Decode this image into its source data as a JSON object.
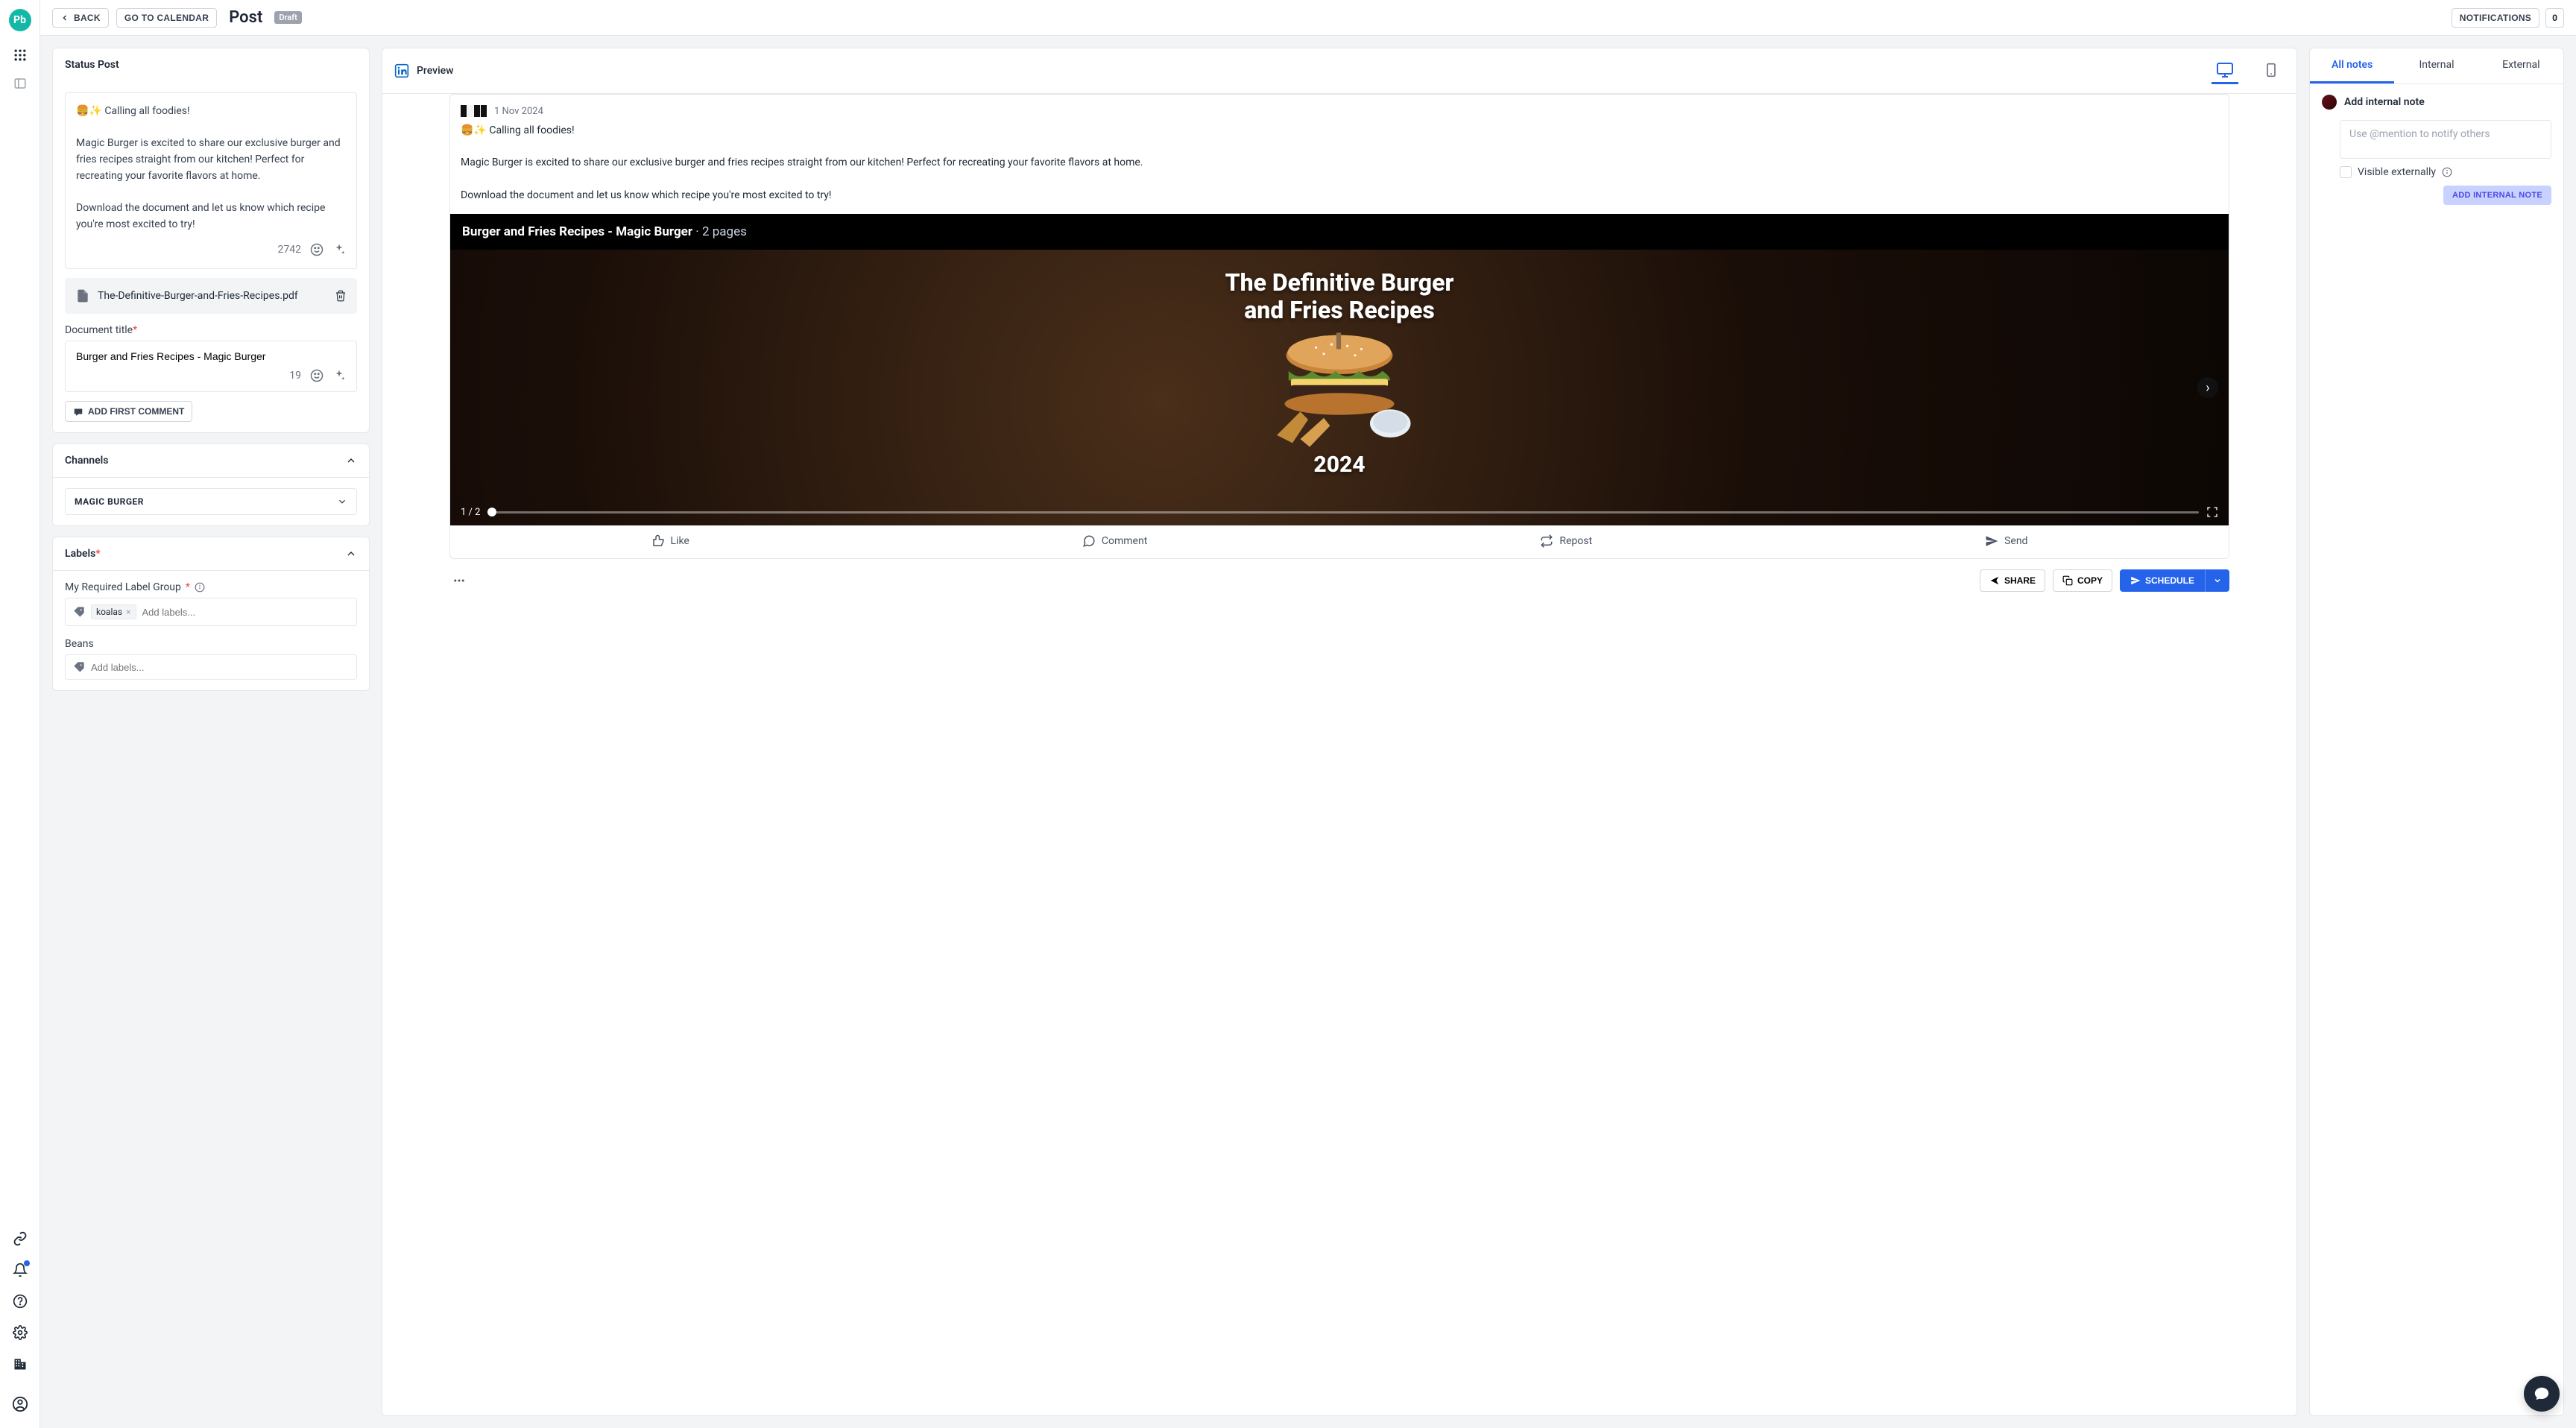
{
  "logo_text": "Pb",
  "topbar": {
    "back": "BACK",
    "calendar": "GO TO CALENDAR",
    "title": "Post",
    "badge": "Draft",
    "notifications": "NOTIFICATIONS",
    "notif_count": "0"
  },
  "status": {
    "header": "Status Post",
    "text_line1": "🍔✨ Calling all foodies!",
    "text_line2": "Magic Burger is excited to share our exclusive burger and fries recipes straight from our kitchen! Perfect for recreating your favorite flavors at home.",
    "text_line3": "Download the document and let us know which recipe you're most excited to try!",
    "char_count": "2742",
    "file_name": "The-Definitive-Burger-and-Fries-Recipes.pdf",
    "doc_title_label": "Document title",
    "doc_title_value": "Burger and Fries Recipes - Magic Burger",
    "doc_title_remaining": "19",
    "add_first_comment": "ADD FIRST COMMENT"
  },
  "channels": {
    "header": "Channels",
    "selected": "MAGIC BURGER"
  },
  "labels": {
    "header": "Labels",
    "group1_label": "My Required Label Group",
    "group1_tag": "koalas",
    "add_labels_placeholder": "Add labels...",
    "group2_label": "Beans"
  },
  "preview": {
    "header": "Preview",
    "date": "1 Nov 2024",
    "text_line1": "🍔✨ Calling all foodies!",
    "text_line2": "Magic Burger is excited to share our exclusive burger and fries recipes straight from our kitchen! Perfect for recreating your favorite flavors at home.",
    "text_line3": "Download the document and let us know which recipe you're most excited to try!",
    "doc_bar_title": "Burger and Fries Recipes - Magic Burger",
    "doc_bar_pages": "2 pages",
    "doc_title_line1": "The Definitive Burger",
    "doc_title_line2": "and Fries Recipes",
    "year": "2024",
    "page_indicator": "1 / 2",
    "actions": {
      "like": "Like",
      "comment": "Comment",
      "repost": "Repost",
      "send": "Send"
    }
  },
  "bottom": {
    "share": "SHARE",
    "copy": "COPY",
    "schedule": "SCHEDULE"
  },
  "notes": {
    "tabs": {
      "all": "All notes",
      "internal": "Internal",
      "external": "External"
    },
    "add_label": "Add internal note",
    "placeholder": "Use @mention to notify others",
    "checkbox": "Visible externally",
    "button": "ADD INTERNAL NOTE"
  }
}
